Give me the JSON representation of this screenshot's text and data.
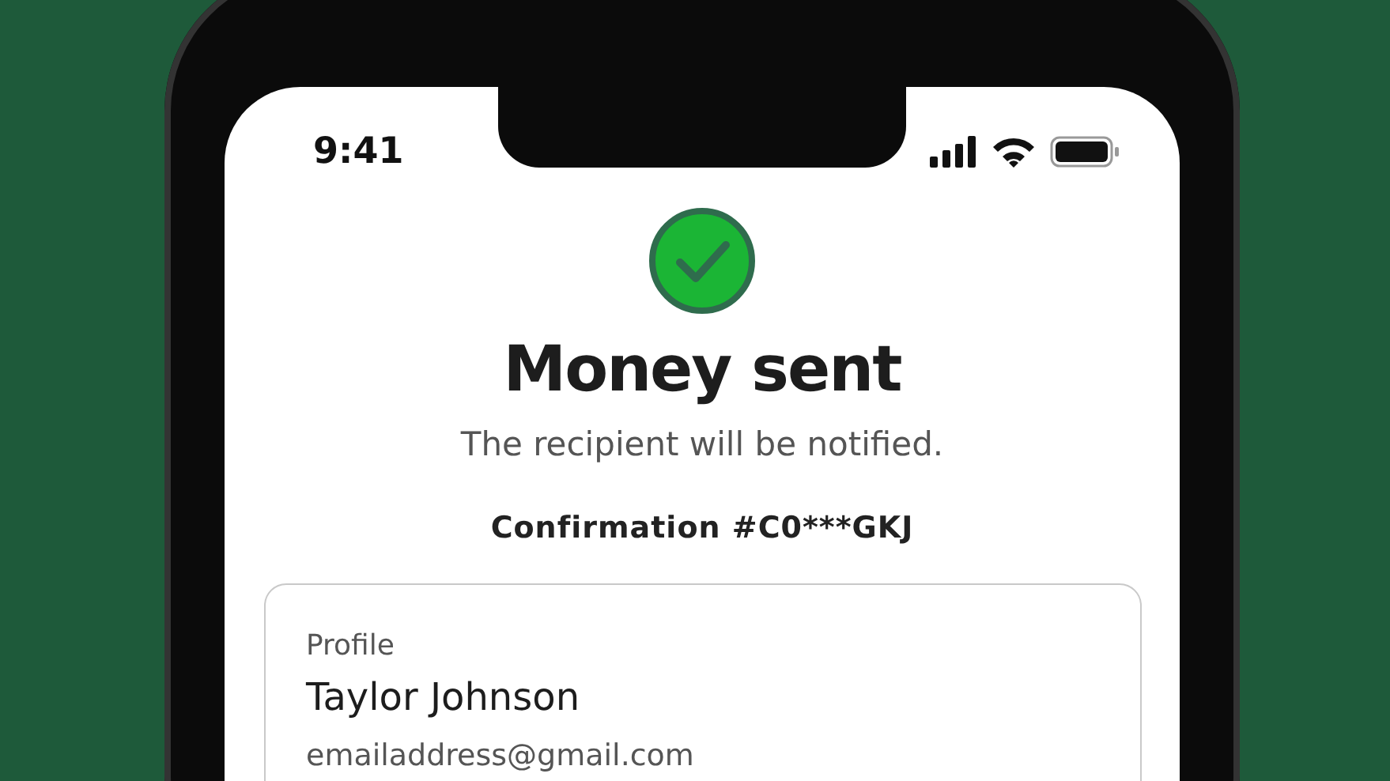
{
  "status_bar": {
    "time": "9:41"
  },
  "confirmation": {
    "success": true,
    "title": "Money sent",
    "subtitle": "The recipient will be notified.",
    "number": "Confirmation #C0***GKJ"
  },
  "card": {
    "label": "Profile",
    "name": "Taylor Johnson",
    "email": "emailaddress@gmail.com"
  }
}
